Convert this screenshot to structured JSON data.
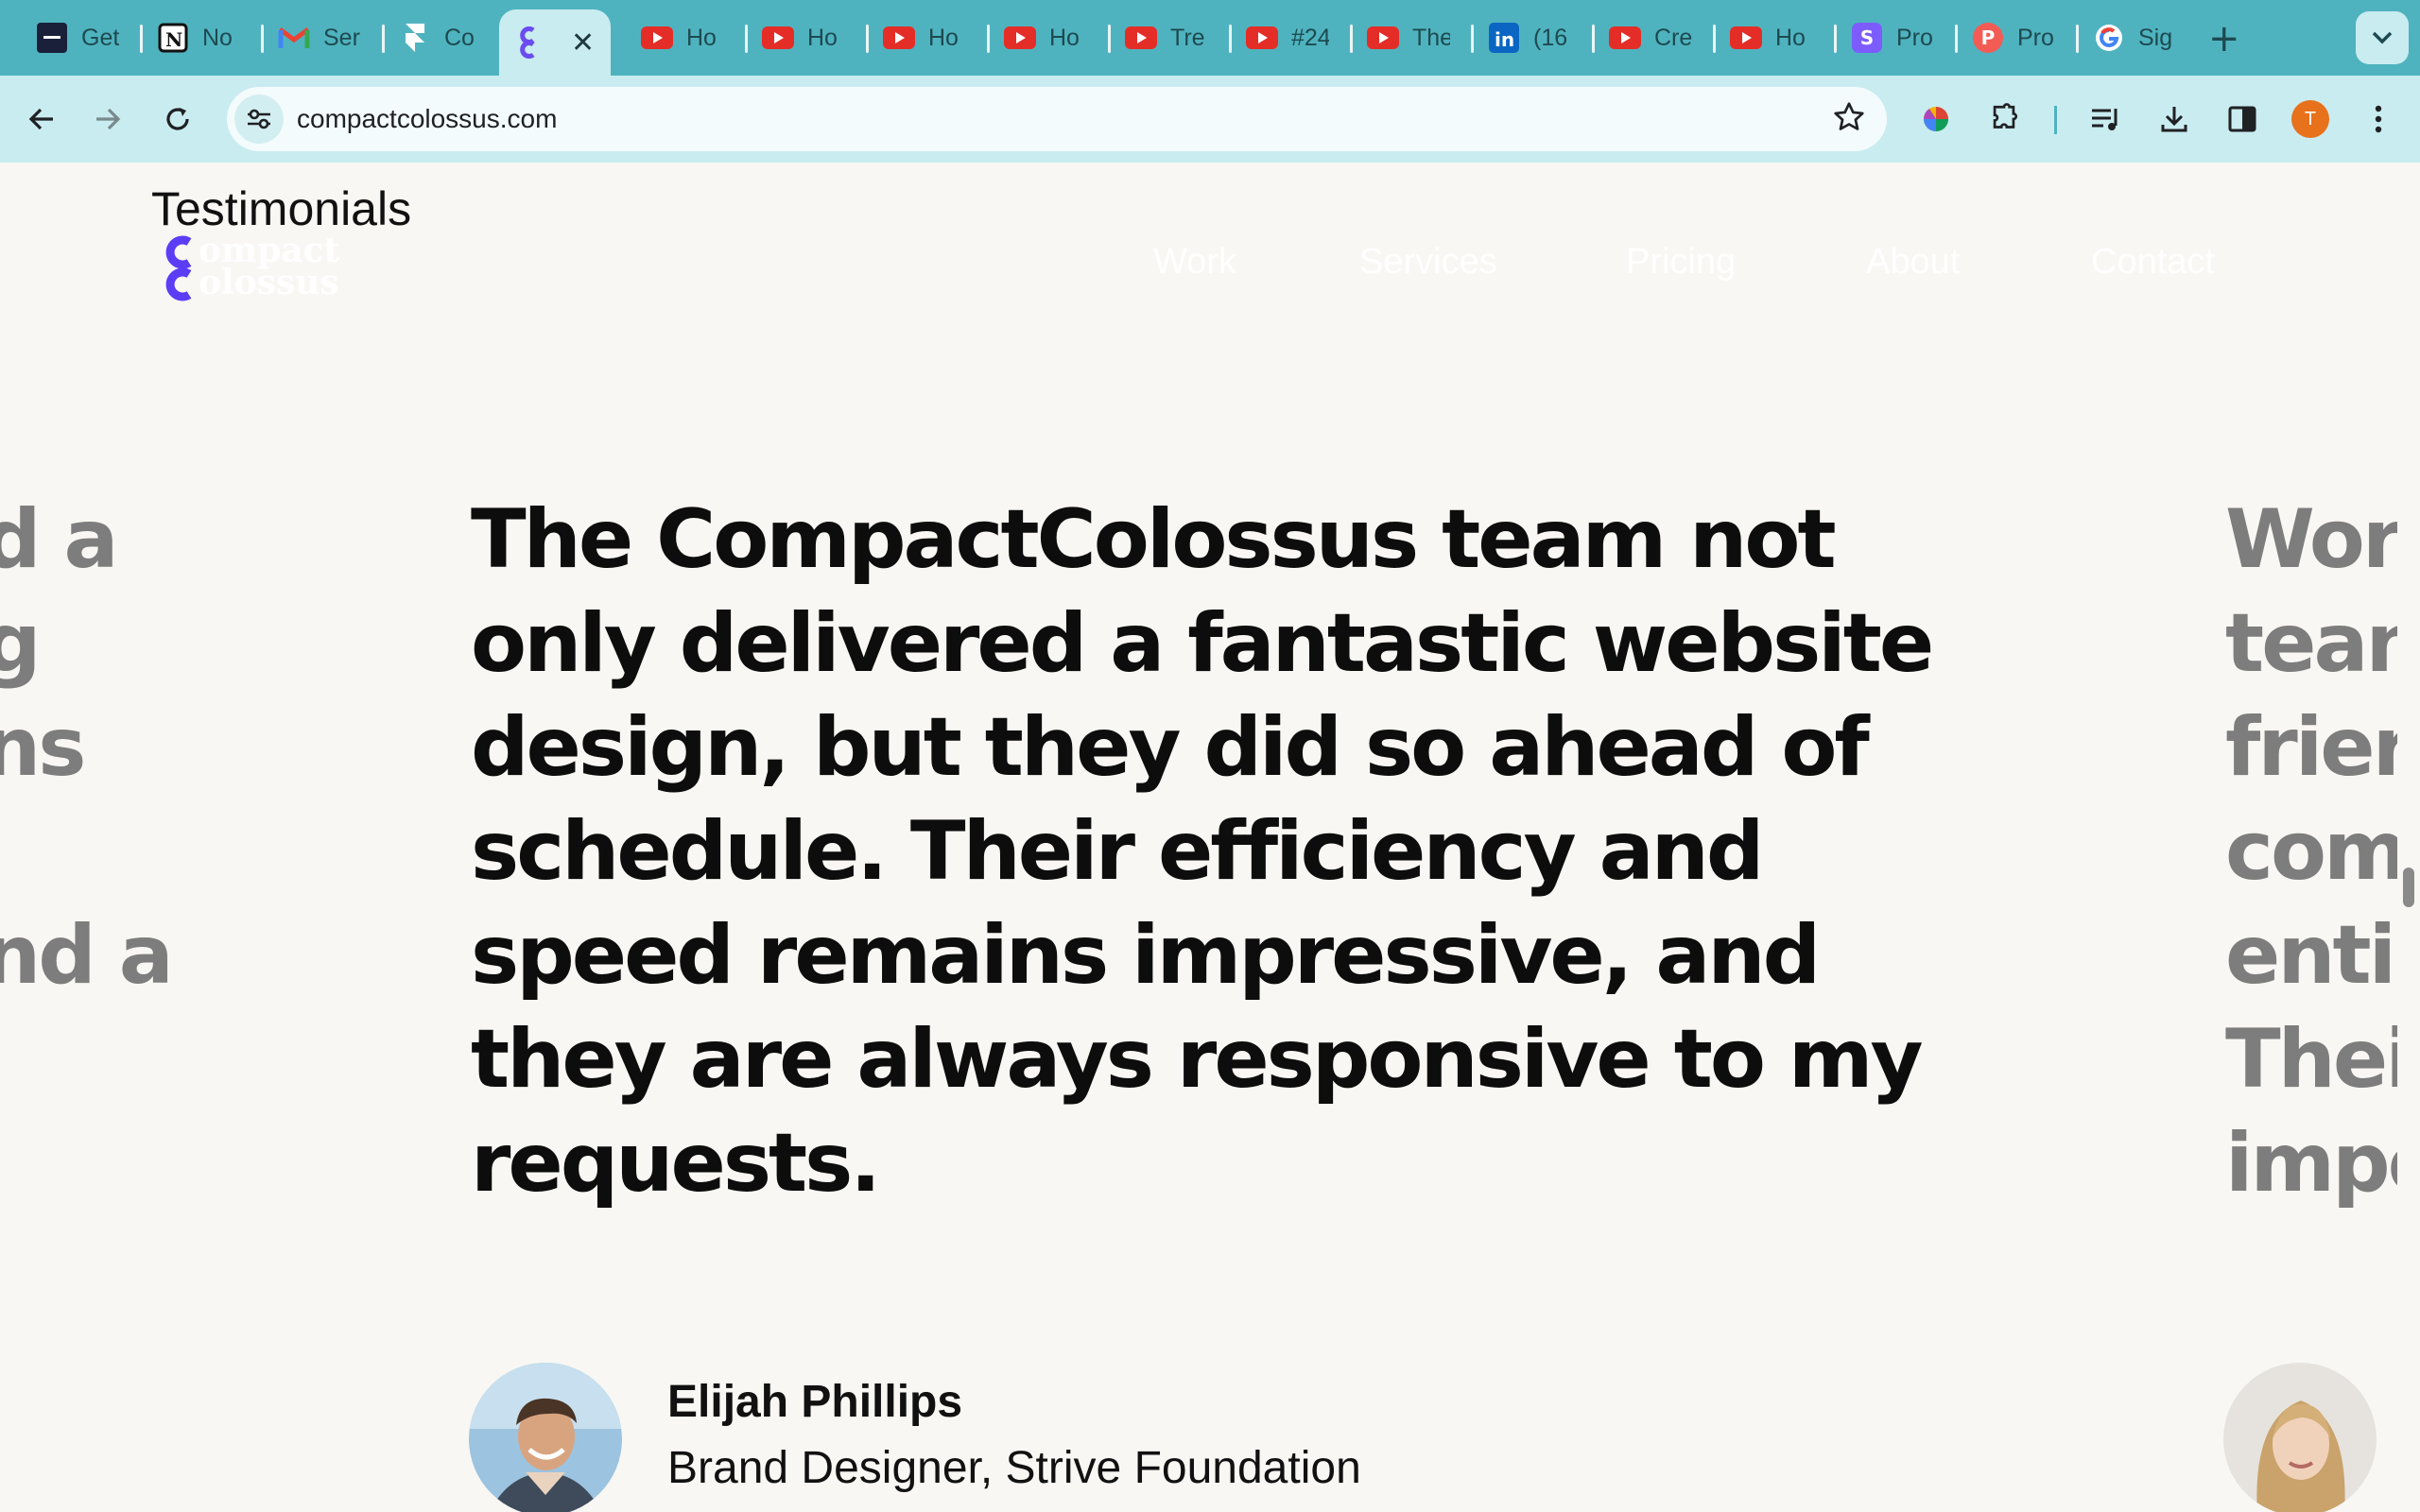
{
  "browser": {
    "tabs": [
      {
        "label": "Get",
        "icon": "dark-app-icon",
        "color": "#1a1f3a"
      },
      {
        "label": "No",
        "icon": "notion-icon",
        "color": "#ffffff"
      },
      {
        "label": "Ser",
        "icon": "gmail-icon",
        "color": "#ea4335"
      },
      {
        "label": "Co",
        "icon": "framer-icon",
        "color": "#ffffff"
      },
      {
        "label": "",
        "icon": "compactcolossus-icon",
        "color": "#6a4cf0",
        "active": true
      },
      {
        "label": "Ho",
        "icon": "youtube-icon",
        "color": "#e52d27"
      },
      {
        "label": "Ho",
        "icon": "youtube-icon",
        "color": "#e52d27"
      },
      {
        "label": "Ho",
        "icon": "youtube-icon",
        "color": "#e52d27"
      },
      {
        "label": "Ho",
        "icon": "youtube-icon",
        "color": "#e52d27"
      },
      {
        "label": "Tre",
        "icon": "youtube-icon",
        "color": "#e52d27"
      },
      {
        "label": "#24",
        "icon": "youtube-icon",
        "color": "#e52d27"
      },
      {
        "label": "The",
        "icon": "youtube-icon",
        "color": "#e52d27"
      },
      {
        "label": "(16",
        "icon": "linkedin-icon",
        "color": "#0a66c2"
      },
      {
        "label": "Cre",
        "icon": "youtube-icon",
        "color": "#e52d27"
      },
      {
        "label": "Ho",
        "icon": "youtube-icon",
        "color": "#e52d27"
      },
      {
        "label": "Pro",
        "icon": "s-app-icon",
        "color": "#7c5cff"
      },
      {
        "label": "Pro",
        "icon": "p-app-icon",
        "color": "#f25c54"
      },
      {
        "label": "Sig",
        "icon": "google-icon",
        "color": "#ffffff"
      }
    ],
    "new_tab_label": "+",
    "url": "compactcolossus.com",
    "profile_initial": "T"
  },
  "page": {
    "section_title": "Testimonials",
    "logo": {
      "line1": "ompact",
      "line2": "olossus",
      "mark_color": "#5b3df5"
    },
    "nav": [
      "Work",
      "Services",
      "Pricing",
      "About",
      "Contact"
    ],
    "quote": "The CompactColossus team not only delivered a fantastic website design, but they did so ahead of schedule. Their efficiency and speed remains impressive, and they are always responsive to my requests.",
    "left_fragments": [
      "d a",
      "g",
      "ns",
      "",
      "nd a"
    ],
    "right_fragments": [
      "Wor",
      "tean",
      "frier",
      "com",
      "enti",
      "Thei",
      "impe"
    ],
    "author": {
      "name": "Elijah Phillips",
      "role": "Brand Designer, Strive Foundation"
    }
  }
}
